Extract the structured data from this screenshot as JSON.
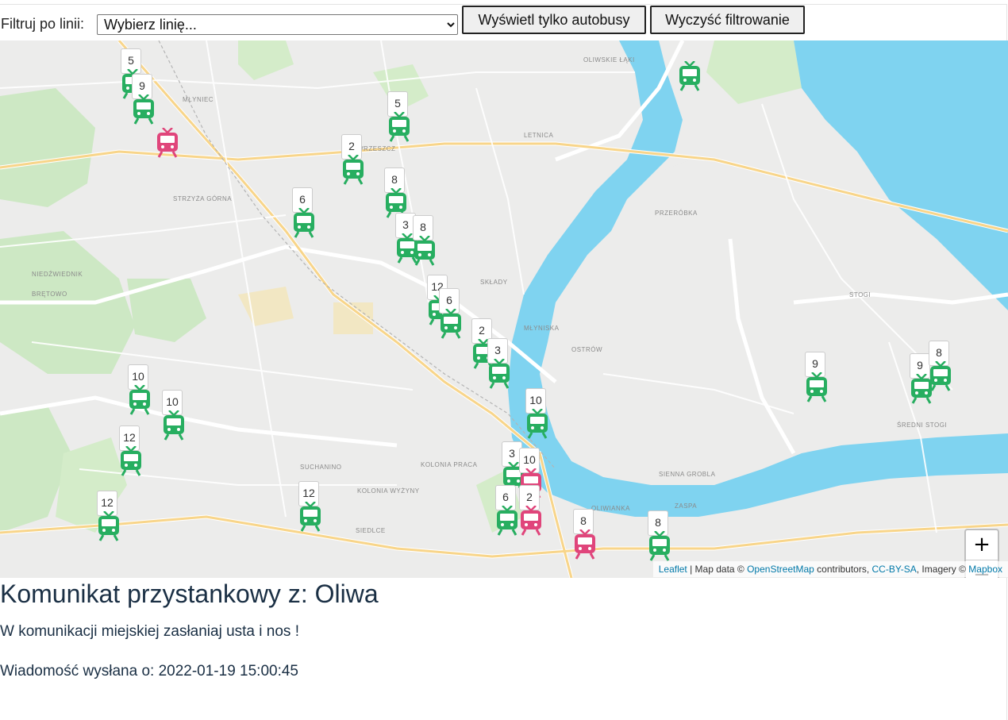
{
  "filter": {
    "label": "Filtruj po linii:",
    "select_value": "Wybierz linię...",
    "bus_button": "Wyświetl tylko autobusy",
    "clear_button": "Wyczyść filtrowanie"
  },
  "map": {
    "zoom_in": "+",
    "zoom_out": "−",
    "attribution": {
      "leaflet": "Leaflet",
      "sep1": " | Map data © ",
      "osm": "OpenStreetMap",
      "sep2": " contributors, ",
      "license": "CC-BY-SA",
      "sep3": ", Imagery © ",
      "mapbox": "Mapbox"
    },
    "colors": {
      "tram": "#27ae60",
      "alert": "#e0457b",
      "water": "#7fd3f0",
      "land": "#ececeb"
    },
    "district_labels": [
      "OLIWSKIE ŁĄKI",
      "LETNICA",
      "PRZERÓBKA",
      "WRZESZCZ",
      "STRZYŻA GÓRNA",
      "SKŁADY",
      "MŁYNISKA",
      "OSTRÓW",
      "STOGI",
      "SIEDLCE",
      "SUCHANINO",
      "KOLONIA WYŻYNY",
      "KOLONIA PRACA",
      "SIENNA GROBLA",
      "ZASPA",
      "MŁYNIEC",
      "BRĘTOWO",
      "NIEDŹWIEDNIK",
      "ŚREDNI STOGI",
      "OLIWIANKA"
    ],
    "markers": [
      {
        "label": "5",
        "color": "#27ae60"
      },
      {
        "label": "9",
        "color": "#27ae60"
      },
      {
        "label": "",
        "color": "#e0457b"
      },
      {
        "label": "5",
        "color": "#27ae60"
      },
      {
        "label": "2",
        "color": "#27ae60"
      },
      {
        "label": "8",
        "color": "#27ae60"
      },
      {
        "label": "6",
        "color": "#27ae60"
      },
      {
        "label": "3",
        "color": "#27ae60"
      },
      {
        "label": "8",
        "color": "#27ae60"
      },
      {
        "label": "12",
        "color": "#27ae60"
      },
      {
        "label": "6",
        "color": "#27ae60"
      },
      {
        "label": "2",
        "color": "#27ae60"
      },
      {
        "label": "3",
        "color": "#27ae60"
      },
      {
        "label": "10",
        "color": "#27ae60"
      },
      {
        "label": "10",
        "color": "#27ae60"
      },
      {
        "label": "10",
        "color": "#27ae60"
      },
      {
        "label": "12",
        "color": "#27ae60"
      },
      {
        "label": "12",
        "color": "#27ae60"
      },
      {
        "label": "12",
        "color": "#27ae60"
      },
      {
        "label": "3",
        "color": "#27ae60"
      },
      {
        "label": "10",
        "color": "#e0457b"
      },
      {
        "label": "6",
        "color": "#27ae60"
      },
      {
        "label": "2",
        "color": "#e0457b"
      },
      {
        "label": "8",
        "color": "#e0457b"
      },
      {
        "label": "8",
        "color": "#27ae60"
      },
      {
        "label": "9",
        "color": "#27ae60"
      },
      {
        "label": "9",
        "color": "#27ae60"
      },
      {
        "label": "8",
        "color": "#27ae60"
      },
      {
        "label": "",
        "color": "#27ae60"
      }
    ]
  },
  "message": {
    "title": "Komunikat przystankowy z: Oliwa",
    "text": "W komunikacji miejskiej zasłaniaj usta i nos !",
    "sent": "Wiadomość wysłana o: 2022-01-19 15:00:45"
  }
}
